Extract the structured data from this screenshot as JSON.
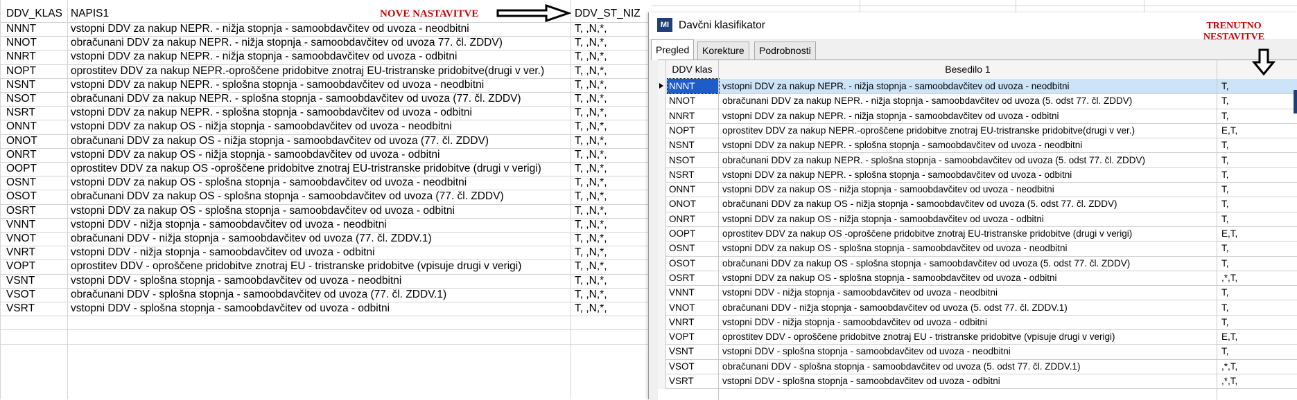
{
  "sheet": {
    "headers": {
      "col_a": "DDV_KLAS",
      "col_b": "NAPIS1",
      "col_c": "DDV_ST_NIZ"
    },
    "annotation": "NOVE NASTAVITVE",
    "rows": [
      {
        "klas": "NNNT",
        "napis": "vstopni DDV za nakup NEPR. - nižja stopnja - samoobdavčitev od uvoza - neodbitni",
        "niz": "T, ,N,*,"
      },
      {
        "klas": "NNOT",
        "napis": "obračunani DDV za nakup NEPR. - nižja stopnja - samoobdavčitev od uvoza 77. čl. ZDDV)",
        "niz": "T, ,N,*,"
      },
      {
        "klas": "NNRT",
        "napis": "vstopni DDV za nakup NEPR. - nižja stopnja - samoobdavčitev od uvoza - odbitni",
        "niz": "T, ,N,*,"
      },
      {
        "klas": "NOPT",
        "napis": "oprostitev DDV za nakup NEPR.-oproščene pridobitve znotraj EU-tristranske pridobitve(drugi v ver.)",
        "niz": "T, ,N,*,"
      },
      {
        "klas": "NSNT",
        "napis": "vstopni DDV za nakup NEPR. - splošna stopnja - samoobdavčitev od uvoza - neodbitni",
        "niz": "T, ,N,*,"
      },
      {
        "klas": "NSOT",
        "napis": "obračunani DDV za nakup NEPR. - splošna stopnja - samoobdavčitev od uvoza (77. čl. ZDDV)",
        "niz": "T, ,N,*,"
      },
      {
        "klas": "NSRT",
        "napis": "vstopni DDV za nakup NEPR. - splošna stopnja - samoobdavčitev od uvoza - odbitni",
        "niz": "T, ,N,*,"
      },
      {
        "klas": "ONNT",
        "napis": "vstopni DDV za nakup OS - nižja stopnja - samoobdavčitev od uvoza - neodbitni",
        "niz": "T, ,N,*,"
      },
      {
        "klas": "ONOT",
        "napis": "obračunani DDV za nakup OS - nižja stopnja - samoobdavčitev od uvoza (77. čl. ZDDV)",
        "niz": "T, ,N,*,"
      },
      {
        "klas": "ONRT",
        "napis": "vstopni DDV za nakup OS - nižja stopnja - samoobdavčitev od uvoza - odbitni",
        "niz": "T, ,N,*,"
      },
      {
        "klas": "OOPT",
        "napis": "oprostitev DDV za nakup OS -oproščene pridobitve znotraj EU-tristranske pridobitve (drugi v verigi)",
        "niz": "T, ,N,*,"
      },
      {
        "klas": "OSNT",
        "napis": "vstopni DDV za nakup OS - splošna stopnja - samoobdavčitev od uvoza - neodbitni",
        "niz": "T, ,N,*,"
      },
      {
        "klas": "OSOT",
        "napis": "obračunani DDV za nakup OS - splošna stopnja - samoobdavčitev od uvoza (77. čl. ZDDV)",
        "niz": "T, ,N,*,"
      },
      {
        "klas": "OSRT",
        "napis": "vstopni DDV za nakup OS - splošna stopnja - samoobdavčitev od uvoza - odbitni",
        "niz": "T, ,N,*,"
      },
      {
        "klas": "VNNT",
        "napis": "vstopni DDV - nižja stopnja - samoobdavčitev od uvoza - neodbitni",
        "niz": "T, ,N,*,"
      },
      {
        "klas": "VNOT",
        "napis": "obračunani DDV - nižja stopnja - samoobdavčitev od uvoza (77. čl. ZDDV.1)",
        "niz": "T, ,N,*,"
      },
      {
        "klas": "VNRT",
        "napis": "vstopni DDV - nižja stopnja - samoobdavčitev od uvoza - odbitni",
        "niz": "T, ,N,*,"
      },
      {
        "klas": "VOPT",
        "napis": "oprostitev DDV - oproščene pridobitve znotraj EU - tristranske pridobitve (vpisuje drugi v verigi)",
        "niz": "T, ,N,*,"
      },
      {
        "klas": "VSNT",
        "napis": "vstopni DDV - splošna stopnja - samoobdavčitev od uvoza - neodbitni",
        "niz": "T, ,N,*,"
      },
      {
        "klas": "VSOT",
        "napis": "obračunani DDV - splošna stopnja - samoobdavčitev od uvoza (77. čl. ZDDV.1)",
        "niz": "T, ,N,*,"
      },
      {
        "klas": "VSRT",
        "napis": "vstopni DDV - splošna stopnja - samoobdavčitev od uvoza - odbitni",
        "niz": "T, ,N,*,"
      }
    ]
  },
  "window": {
    "title": "Davčni klasifikator",
    "icon_text": "MI",
    "annotation": "TRENUTNO NESTAVITVE",
    "tabs": [
      "Pregled",
      "Korekture",
      "Podrobnosti"
    ],
    "columns": {
      "klas": "DDV klas",
      "besedilo": "Besedilo 1",
      "st": ""
    },
    "rows": [
      {
        "klas": "NNNT",
        "besedilo": "vstopni DDV za nakup NEPR. - nižja stopnja - samoobdavčitev od uvoza - neodbitni",
        "st": "T,"
      },
      {
        "klas": "NNOT",
        "besedilo": "obračunani DDV za nakup NEPR. - nižja stopnja - samoobdavčitev od uvoza (5. odst 77. čl. ZDDV)",
        "st": "T,"
      },
      {
        "klas": "NNRT",
        "besedilo": "vstopni DDV za nakup NEPR. - nižja stopnja - samoobdavčitev od uvoza - odbitni",
        "st": "T,"
      },
      {
        "klas": "NOPT",
        "besedilo": "oprostitev DDV za nakup NEPR.-oproščene pridobitve znotraj EU-tristranske pridobitve(drugi v ver.)",
        "st": "E,T,"
      },
      {
        "klas": "NSNT",
        "besedilo": "vstopni DDV za nakup NEPR. - splošna stopnja - samoobdavčitev od uvoza - neodbitni",
        "st": "T,"
      },
      {
        "klas": "NSOT",
        "besedilo": "obračunani DDV za nakup NEPR. - splošna stopnja - samoobdavčitev od uvoza (5. odst 77. čl. ZDDV)",
        "st": "T,"
      },
      {
        "klas": "NSRT",
        "besedilo": "vstopni DDV za nakup NEPR. - splošna stopnja - samoobdavčitev od uvoza - odbitni",
        "st": "T,"
      },
      {
        "klas": "ONNT",
        "besedilo": "vstopni DDV za nakup OS - nižja stopnja - samoobdavčitev od uvoza - neodbitni",
        "st": "T,"
      },
      {
        "klas": "ONOT",
        "besedilo": "obračunani DDV za nakup OS - nižja stopnja - samoobdavčitev od uvoza (5. odst 77. čl. ZDDV)",
        "st": "T,"
      },
      {
        "klas": "ONRT",
        "besedilo": "vstopni DDV za nakup OS - nižja stopnja - samoobdavčitev od uvoza - odbitni",
        "st": "T,"
      },
      {
        "klas": "OOPT",
        "besedilo": "oprostitev DDV za nakup OS -oproščene pridobitve znotraj EU-tristranske pridobitve (drugi v verigi)",
        "st": "E,T,"
      },
      {
        "klas": "OSNT",
        "besedilo": "vstopni DDV za nakup OS - splošna stopnja - samoobdavčitev od uvoza - neodbitni",
        "st": "T,"
      },
      {
        "klas": "OSOT",
        "besedilo": "obračunani DDV za nakup OS - splošna stopnja - samoobdavčitev od uvoza (5. odst 77. čl. ZDDV)",
        "st": "T,"
      },
      {
        "klas": "OSRT",
        "besedilo": "vstopni DDV za nakup OS - splošna stopnja - samoobdavčitev od uvoza - odbitni",
        "st": ",*,T,"
      },
      {
        "klas": "VNNT",
        "besedilo": "vstopni DDV - nižja stopnja - samoobdavčitev od uvoza - neodbitni",
        "st": "T,"
      },
      {
        "klas": "VNOT",
        "besedilo": "obračunani DDV - nižja stopnja - samoobdavčitev od uvoza (5. odst 77. čl. ZDDV.1)",
        "st": "T,"
      },
      {
        "klas": "VNRT",
        "besedilo": "vstopni DDV - nižja stopnja - samoobdavčitev od uvoza - odbitni",
        "st": "T,"
      },
      {
        "klas": "VOPT",
        "besedilo": "oprostitev DDV - oproščene pridobitve znotraj EU - tristranske pridobitve (vpisuje drugi v verigi)",
        "st": "E,T,"
      },
      {
        "klas": "VSNT",
        "besedilo": "vstopni DDV - splošna stopnja - samoobdavčitev od uvoza - neodbitni",
        "st": "T,"
      },
      {
        "klas": "VSOT",
        "besedilo": "obračunani DDV - splošna stopnja - samoobdavčitev od uvoza (5. odst 77. čl. ZDDV.1)",
        "st": ",*,T,"
      },
      {
        "klas": "VSRT",
        "besedilo": "vstopni DDV - splošna stopnja - samoobdavčitev od uvoza - odbitni",
        "st": ",*,T,"
      }
    ]
  },
  "colors": {
    "annotation_red": "#cc0000",
    "selection": "#1e5cc8",
    "grid_line": "#d4d4d4"
  }
}
